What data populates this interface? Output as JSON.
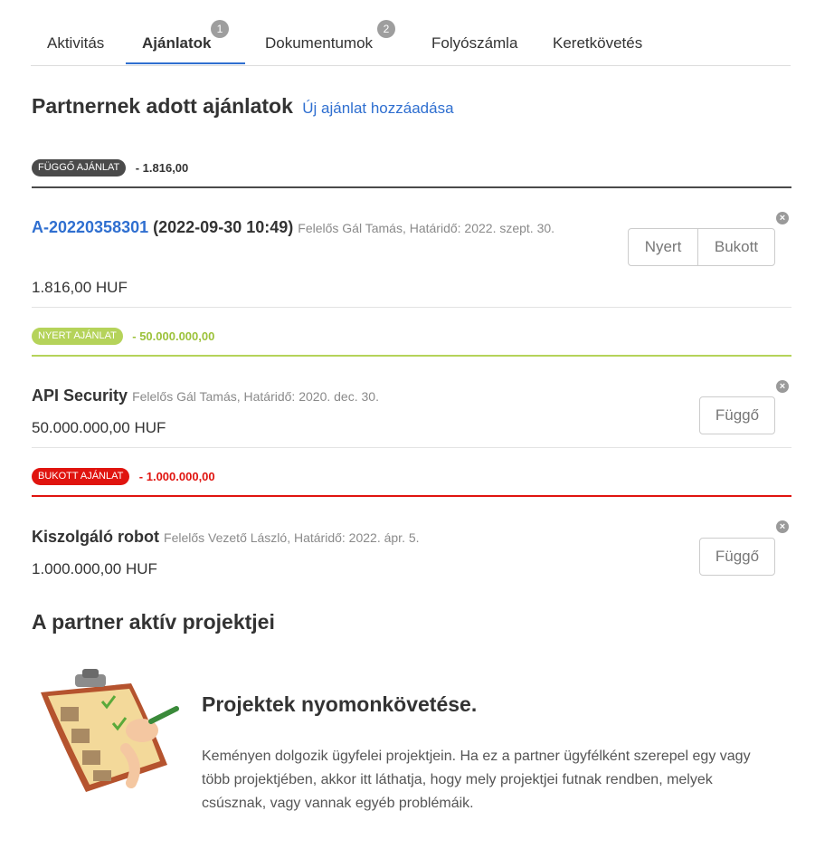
{
  "tabs": [
    {
      "label": "Aktivitás",
      "badge": null
    },
    {
      "label": "Ajánlatok",
      "badge": "1",
      "active": true
    },
    {
      "label": "Dokumentumok",
      "badge": "2"
    },
    {
      "label": "Folyószámla",
      "badge": null
    },
    {
      "label": "Keretkövetés",
      "badge": null
    }
  ],
  "page": {
    "title": "Partnernek adott ajánlatok",
    "add_link": "Új ajánlat hozzáadása"
  },
  "groups": [
    {
      "status": "FÜGGŐ AJÁNLAT",
      "sum": "- 1.816,00",
      "color": "#4a4a4a",
      "offers": [
        {
          "code": "A-20220358301",
          "date": "(2022-09-30 10:49)",
          "meta": "Felelős Gál Tamás, Határidő: 2022. szept. 30.",
          "amount": "1.816,00 HUF",
          "buttons": [
            "Nyert",
            "Bukott"
          ]
        }
      ]
    },
    {
      "status": "NYERT AJÁNLAT",
      "sum": "- 50.000.000,00",
      "color": "#b5d35a",
      "offers": [
        {
          "name": "API Security",
          "meta": "Felelős Gál Tamás, Határidő: 2020. dec. 30.",
          "amount": "50.000.000,00 HUF",
          "buttons": [
            "Függő"
          ]
        }
      ]
    },
    {
      "status": "BUKOTT AJÁNLAT",
      "sum": "- 1.000.000,00",
      "color": "#e0140f",
      "offers": [
        {
          "name": "Kiszolgáló robot",
          "meta": "Felelős Vezető László, Határidő: 2022. ápr. 5.",
          "amount": "1.000.000,00 HUF",
          "buttons": [
            "Függő"
          ]
        }
      ]
    }
  ],
  "projects": {
    "heading": "A partner aktív projektjei",
    "title": "Projektek nyomonkövetése.",
    "text": "Keményen dolgozik ügyfelei projektjein. Ha ez a partner ügyfélként szerepel egy vagy több projektjében, akkor itt láthatja, hogy mely projektjei futnak rendben, melyek csúsznak, vagy vannak egyéb problémáik.",
    "illustration_icon": "clipboard-checklist-illustration"
  },
  "colors": {
    "link": "#2f6fd0",
    "pending": "#4a4a4a",
    "won": "#b5d35a",
    "lost": "#e0140f"
  }
}
